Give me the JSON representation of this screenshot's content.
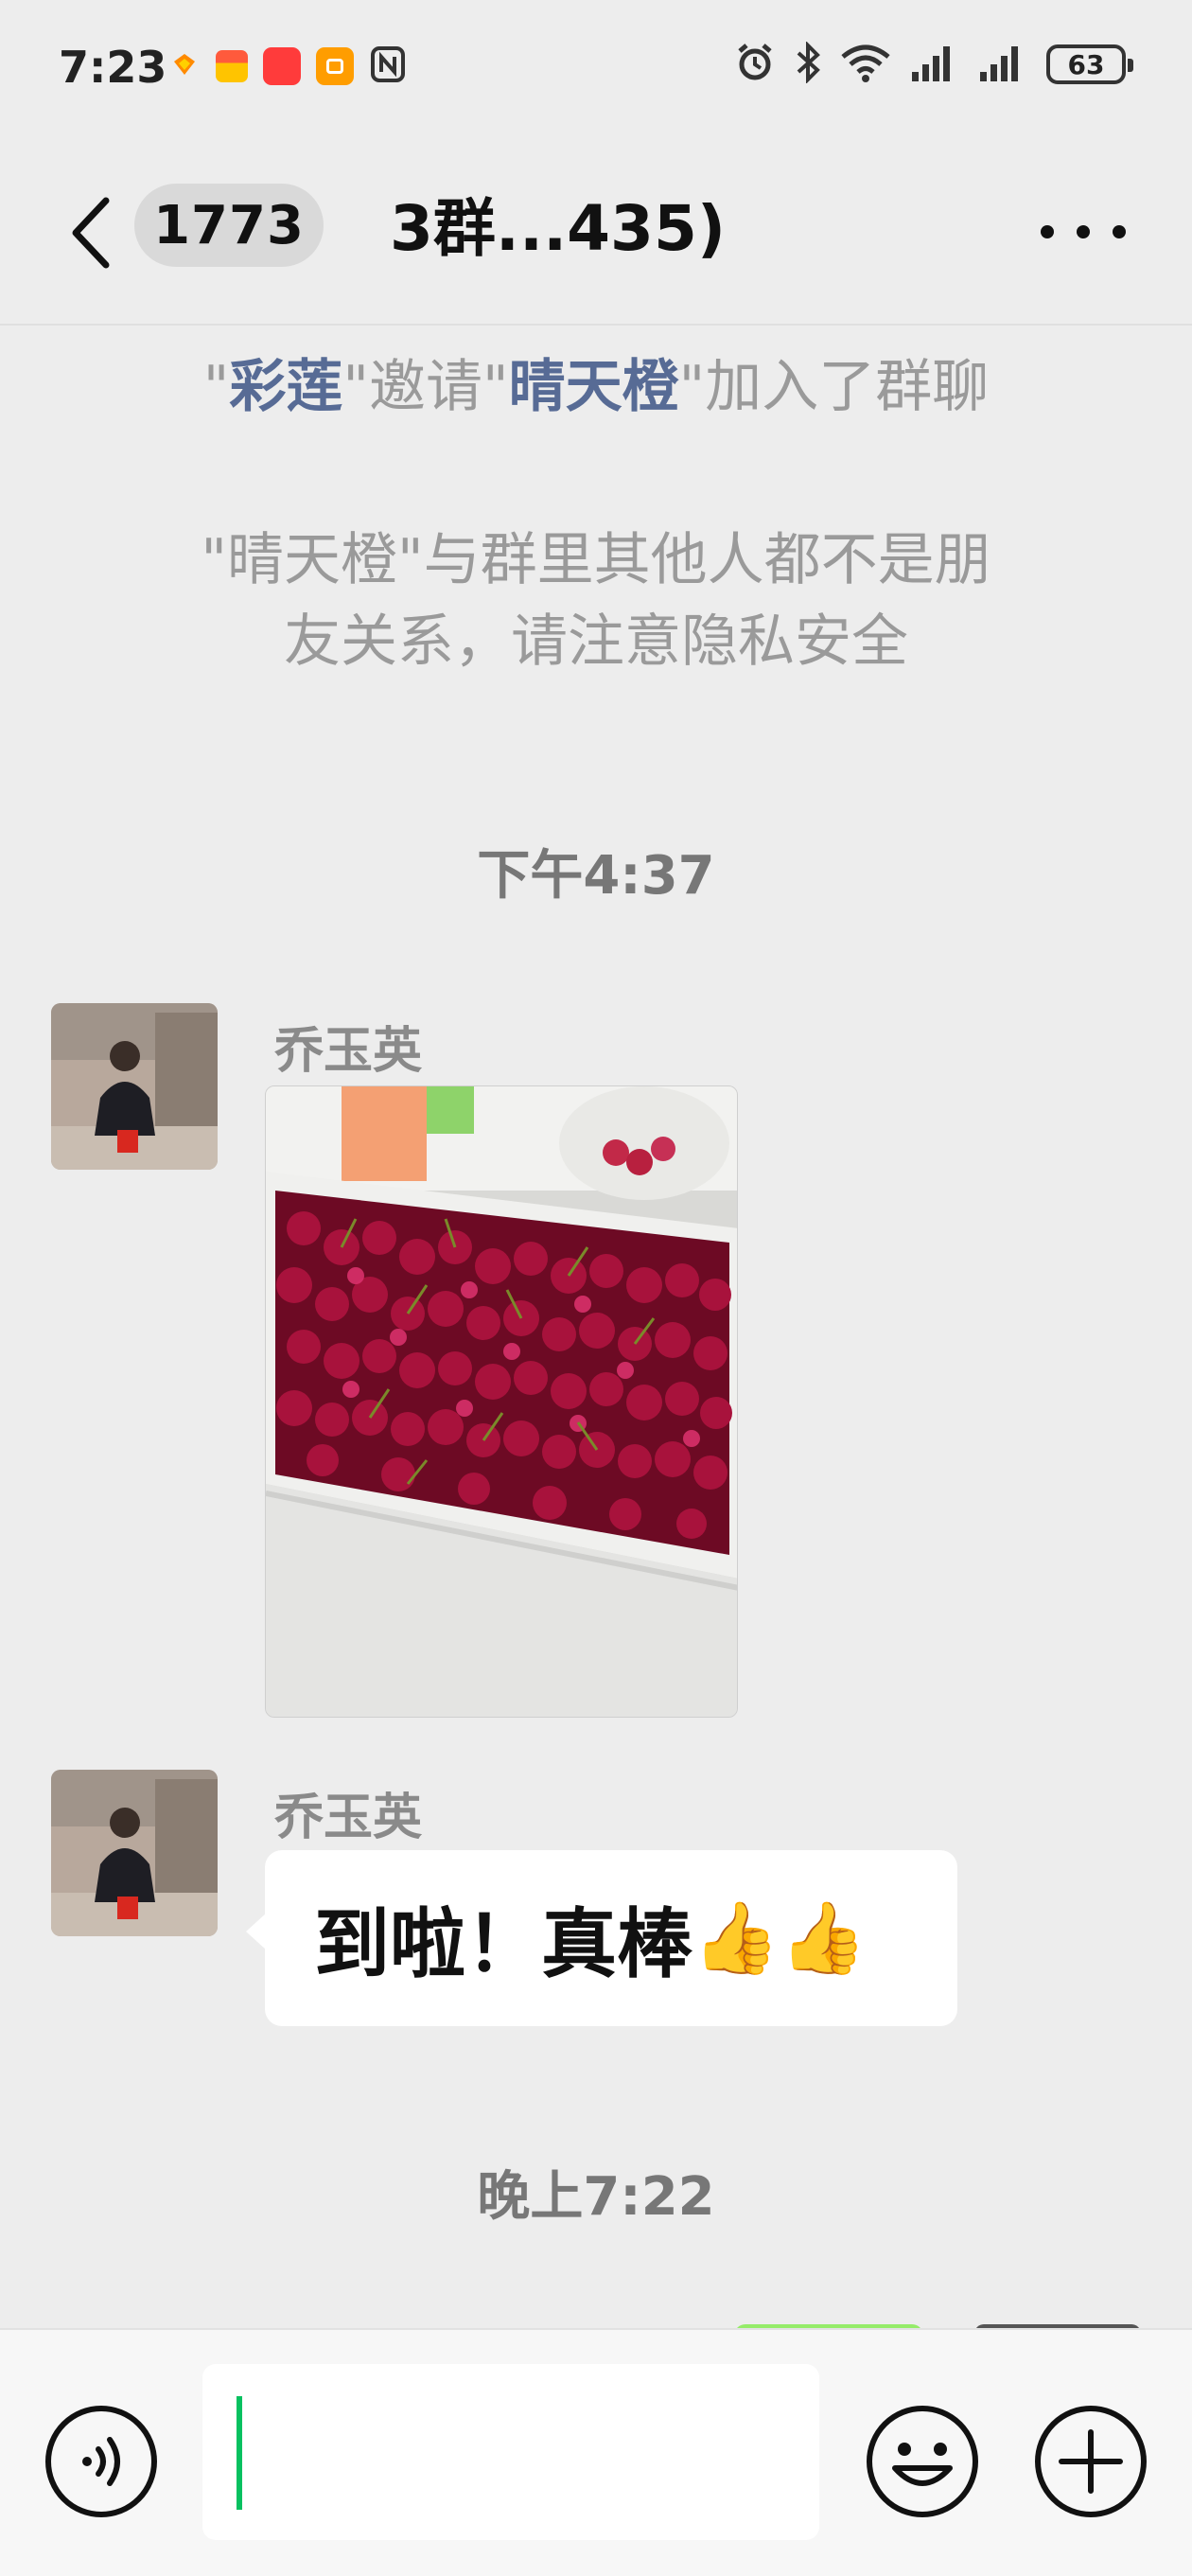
{
  "status_bar": {
    "time": "7:23",
    "battery": "63",
    "app_icons": [
      "taobao-icon",
      "memo-icon",
      "shopping-icon",
      "toggle-app-icon",
      "nfc-icon"
    ],
    "system_icons": [
      "alarm-icon",
      "bluetooth-icon",
      "wifi-icon",
      "signal-icon",
      "signal-icon",
      "battery-icon"
    ]
  },
  "navbar": {
    "unread_count": "1773",
    "title": "3群...435)"
  },
  "messages": {
    "system_invite": {
      "q1": "\"",
      "inviter": "彩莲",
      "q2": "\"邀请\"",
      "invitee": "晴天橙",
      "q3": "\"加入了群聊"
    },
    "system_privacy_line1": "\"晴天橙\"与群里其他人都不是朋",
    "system_privacy_line2": "友关系，请注意隐私安全",
    "timestamp_1": "下午4:37",
    "msg1_sender": "乔玉英",
    "msg2_sender": "乔玉英",
    "msg2_text": "到啦！真棒",
    "msg2_emoji": "👍👍",
    "timestamp_2": "晚上7:22"
  },
  "input": {
    "value": ""
  },
  "colors": {
    "background": "#ededed",
    "link": "#576b95",
    "caret": "#07c160",
    "bubble": "#ffffff"
  }
}
